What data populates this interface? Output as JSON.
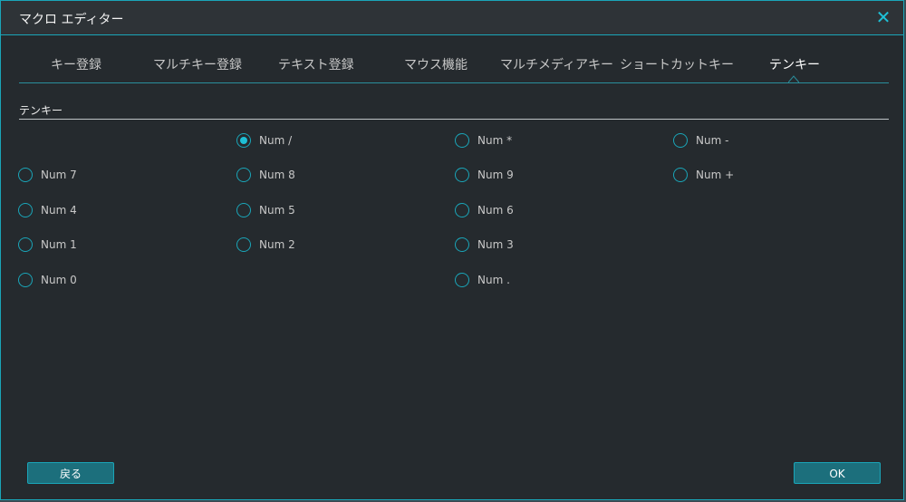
{
  "window": {
    "title": "マクロ エディター",
    "close_glyph": "✕"
  },
  "tabs": [
    {
      "label": "キー登録",
      "active": false
    },
    {
      "label": "マルチキー登録",
      "active": false
    },
    {
      "label": "テキスト登録",
      "active": false
    },
    {
      "label": "マウス機能",
      "active": false
    },
    {
      "label": "マルチメディアキー",
      "active": false
    },
    {
      "label": "ショートカットキー",
      "active": false
    },
    {
      "label": "テンキー",
      "active": true
    }
  ],
  "section": {
    "label": "テンキー"
  },
  "keys": {
    "num_slash": {
      "label": "Num /",
      "checked": true
    },
    "num_star": {
      "label": "Num *",
      "checked": false
    },
    "num_minus": {
      "label": "Num -",
      "checked": false
    },
    "num_7": {
      "label": "Num 7",
      "checked": false
    },
    "num_8": {
      "label": "Num 8",
      "checked": false
    },
    "num_9": {
      "label": "Num 9",
      "checked": false
    },
    "num_plus": {
      "label": "Num +",
      "checked": false
    },
    "num_4": {
      "label": "Num 4",
      "checked": false
    },
    "num_5": {
      "label": "Num 5",
      "checked": false
    },
    "num_6": {
      "label": "Num 6",
      "checked": false
    },
    "num_1": {
      "label": "Num 1",
      "checked": false
    },
    "num_2": {
      "label": "Num 2",
      "checked": false
    },
    "num_3": {
      "label": "Num 3",
      "checked": false
    },
    "num_0": {
      "label": "Num 0",
      "checked": false
    },
    "num_dot": {
      "label": "Num .",
      "checked": false
    }
  },
  "buttons": {
    "back_label": "戻る",
    "ok_label": "OK"
  },
  "colors": {
    "accent": "#1aa5b8",
    "background": "#252a2e",
    "button": "#1c6f7c"
  }
}
